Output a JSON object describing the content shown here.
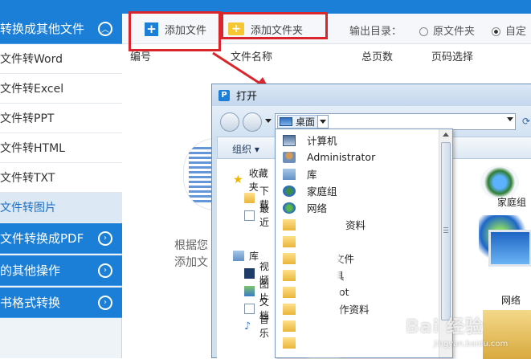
{
  "sidebar": {
    "top_category": "转换成其他文件",
    "items": [
      {
        "label": "文件转Word"
      },
      {
        "label": "文件转Excel"
      },
      {
        "label": "文件转PPT"
      },
      {
        "label": "文件转HTML"
      },
      {
        "label": "文件转TXT"
      },
      {
        "label": "文件转图片"
      }
    ],
    "categories": [
      {
        "label": "文件转换成PDF"
      },
      {
        "label": "的其他操作"
      },
      {
        "label": "书格式转换"
      }
    ]
  },
  "toolbar": {
    "add_file": "添加文件",
    "add_folder": "添加文件夹",
    "output_label": "输出目录：",
    "opt_original": "原文件夹",
    "opt_custom": "自定"
  },
  "table": {
    "headers": [
      "编号",
      "文件名称",
      "总页数",
      "页码选择"
    ]
  },
  "main_hint": {
    "line1": "根据您",
    "line2": "添加文"
  },
  "dialog": {
    "title": "打开",
    "address": "桌面",
    "organize": "组织",
    "nav": [
      {
        "label": "收藏夹"
      },
      {
        "label": "下载"
      },
      {
        "label": "最近"
      },
      {
        "label": "库"
      },
      {
        "label": "视频"
      },
      {
        "label": "图片"
      },
      {
        "label": "文档"
      },
      {
        "label": "音乐"
      }
    ],
    "dropdown": [
      {
        "label": "计算机",
        "icon": "computer-icon"
      },
      {
        "label": "Administrator",
        "icon": "user-icon"
      },
      {
        "label": "库",
        "icon": "library-icon"
      },
      {
        "label": "家庭组",
        "icon": "homegroup-icon"
      },
      {
        "label": "网络",
        "icon": "network-icon"
      },
      {
        "label": "资料",
        "icon": "folder-icon"
      },
      {
        "label": "",
        "icon": "folder-icon"
      },
      {
        "label": "文件",
        "icon": "folder-icon"
      },
      {
        "label": "具",
        "icon": "folder-icon"
      },
      {
        "label": "ot",
        "icon": "folder-icon"
      },
      {
        "label": "作资料",
        "icon": "folder-icon"
      },
      {
        "label": "",
        "icon": "folder-icon"
      },
      {
        "label": "",
        "icon": "folder-icon"
      },
      {
        "label": "",
        "icon": "folder-icon"
      }
    ],
    "content_labels": {
      "homegroup": "家庭组",
      "network": "网络"
    }
  },
  "watermark": {
    "text": "Bai 经验",
    "sub": "jingyan.baidu.com"
  }
}
